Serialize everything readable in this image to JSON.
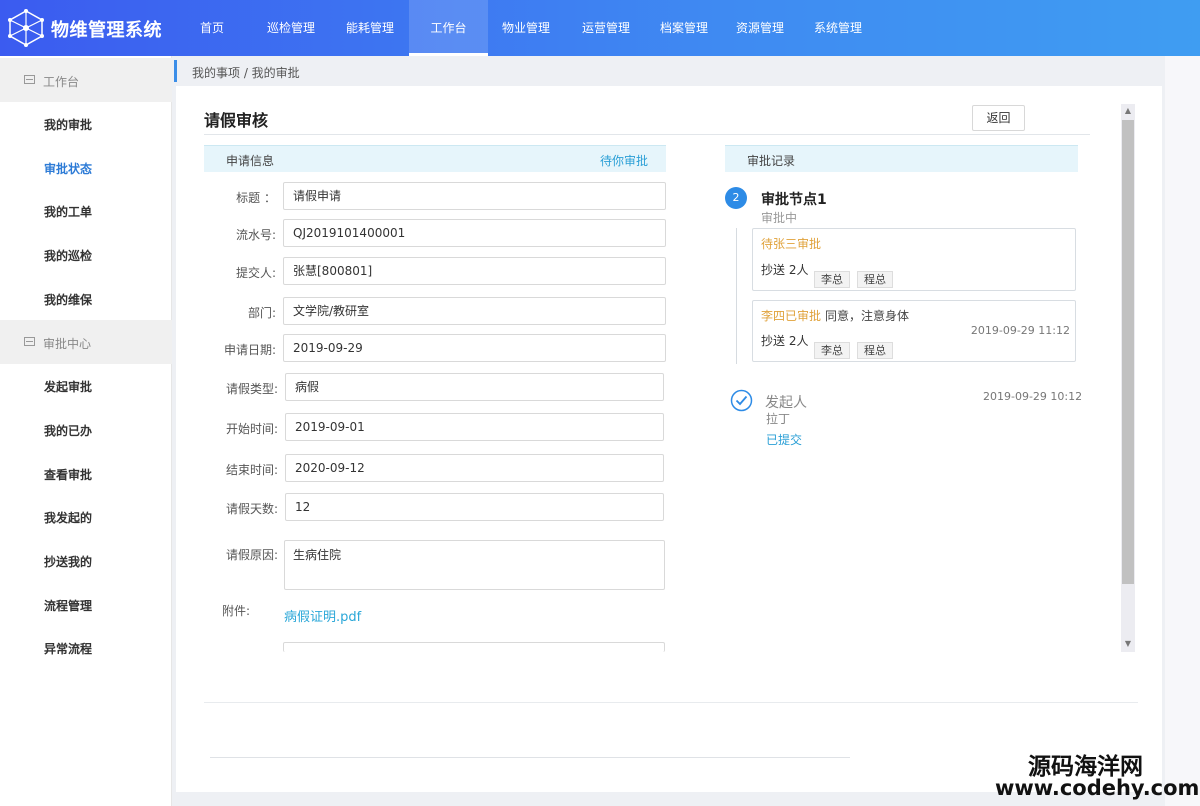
{
  "app": {
    "title": "物维管理系统",
    "nav": [
      "首页",
      "巡检管理",
      "能耗管理",
      "工作台",
      "物业管理",
      "运营管理",
      "档案管理",
      "资源管理",
      "系统管理"
    ],
    "active_nav": "工作台"
  },
  "sidebar": {
    "group1": "工作台",
    "group1_items": [
      "我的审批",
      "审批状态",
      "我的工单",
      "我的巡检",
      "我的维保"
    ],
    "group2": "审批中心",
    "group2_items": [
      "发起审批",
      "我的已办",
      "查看审批",
      "我发起的",
      "抄送我的",
      "流程管理",
      "异常流程"
    ],
    "active_item": "审批状态"
  },
  "breadcrumb": "我的事项 / 我的审批",
  "page": {
    "title": "请假审核",
    "back_label": "返回"
  },
  "application": {
    "section_title": "申请信息",
    "status": "待你审批",
    "fields": {
      "title_label": "标题 ：",
      "title_value": "请假申请",
      "serial_label": "流水号:",
      "serial_value": "QJ2019101400001",
      "submitter_label": "提交人:",
      "submitter_value": "张慧[800801]",
      "dept_label": "部门:",
      "dept_value": "文学院/教研室",
      "date_label": "申请日期:",
      "date_value": "2019-09-29",
      "type_label": "请假类型:",
      "type_value": "病假",
      "start_label": "开始时间:",
      "start_value": "2019-09-01",
      "end_label": "结束时间:",
      "end_value": "2020-09-12",
      "days_label": "请假天数:",
      "days_value": "12",
      "reason_label": "请假原因:",
      "reason_value": "生病住院",
      "attach_label": "附件:",
      "attach_value": "病假证明.pdf"
    }
  },
  "record": {
    "section_title": "审批记录",
    "node": {
      "step": "2",
      "title": "审批节点1",
      "status": "审批中",
      "cards": [
        {
          "who": "待张三审批",
          "comment": "",
          "time": "",
          "cc_label": "抄送 2人",
          "cc": [
            "李总",
            "程总"
          ]
        },
        {
          "who": "李四已审批",
          "comment": "同意，注意身体",
          "time": "2019-09-29 11:12",
          "cc_label": "抄送 2人",
          "cc": [
            "李总",
            "程总"
          ]
        }
      ]
    },
    "initiator": {
      "title": "发起人",
      "name": "拉丁",
      "status": "已提交",
      "time": "2019-09-29 10:12"
    }
  },
  "watermark": {
    "line1": "源码海洋网",
    "line2": "www.codehy.com"
  },
  "colors": {
    "nav_gradient_start": "#3b5bf0",
    "nav_gradient_end": "#3f9df2",
    "accent_link": "#2a9fd6",
    "pending_orange": "#e0a23b",
    "section_bg": "#e6f5fb"
  },
  "icons": {
    "logo": "network-logo-icon",
    "group": "list-icon",
    "step": "step-number-icon",
    "initiator": "check-circle-icon"
  }
}
